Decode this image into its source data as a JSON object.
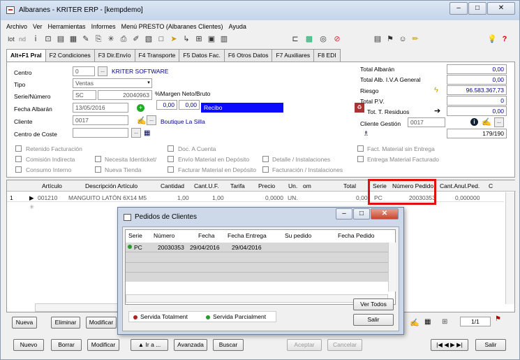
{
  "window": {
    "title": "Albaranes - KRITER ERP -  [kempdemo]"
  },
  "menu": [
    "Archivo",
    "Ver",
    "Herramientas",
    "Informes",
    "Menú PRESTO (Albaranes Clientes)",
    "Ayuda"
  ],
  "toolbar": {
    "icons": [
      "lot-icon",
      "nd-icon",
      "info-icon",
      "id-icon",
      "copy-icon",
      "print-preview-icon",
      "magic-icon",
      "print-icon",
      "asterisk-icon",
      "printer-icon",
      "chart-icon",
      "square-icon",
      "pin-icon",
      "arrow-icon",
      "screen-icon",
      "calc-icon",
      "module-icon",
      "warehouse-icon",
      "stamp-icon",
      "money-icon",
      "target-icon",
      "euro-icon",
      "map-icon",
      "folder-icon",
      "bulb-icon",
      "help-icon"
    ],
    "text_lot": "lot",
    "text_nd": "nd"
  },
  "tabs": [
    "Alt+F1 Pral",
    "F2 Condiciones",
    "F3 Dir.Envío",
    "F4 Transporte",
    "F5 Datos Fac.",
    "F6 Otros Datos",
    "F7 Auxiliares",
    "F8 EDI"
  ],
  "form": {
    "centro_label": "Centro",
    "centro_code": "0",
    "centro_name": "KRITER SOFTWARE",
    "tipo_label": "Tipo",
    "tipo_value": "Ventas",
    "serie_label": "Serie/Número",
    "serie_value": "SC",
    "numero_value": "20040963",
    "margen_label": "%Margen Neto/Bruto",
    "margen_neto": "0,00",
    "margen_bruto": "0,00",
    "recibo": "Recibo",
    "fecha_label": "Fecha Albarán",
    "fecha_value": "13/05/2016",
    "cliente_label": "Cliente",
    "cliente_code": "0017",
    "cliente_name": "Boutique La Silla",
    "coste_label": "Centro de Coste"
  },
  "totals": {
    "total_albaran_label": "Total Albarán",
    "total_albaran": "0,00",
    "total_iva_label": "Total Alb. I.V.A General",
    "total_iva": "0,00",
    "riesgo_label": "Riesgo",
    "riesgo": "96.583.367,73",
    "total_pv_label": "Total P.V.",
    "total_pv": "0",
    "residuos_label": "Tot. T. Residuos",
    "residuos": "0,00",
    "gestion_label": "Cliente Gestión",
    "gestion_code": "0017",
    "pager": "179/190"
  },
  "checks": [
    "Retenido Facturación",
    "Comisión Indirecta",
    "Necesita Identicket/",
    "Consumo Interno",
    "Nueva Tienda",
    "Doc. A Cuenta",
    "Envío Material en Depósito",
    "Detalle / Instalaciones",
    "Facturar Material en Depósito",
    "Facturación / Instalaciones",
    "Fact. Material sin Entrega",
    "Entrega Material Facturado"
  ],
  "grid": {
    "headers": [
      "Artículo",
      "Descripción Artículo",
      "Cantidad",
      "Cant.U.F.",
      "Tarifa",
      "Precio",
      "Un.",
      "om",
      "Total",
      "Serie",
      "Número Pedido",
      "Cant.Anul.Ped.",
      "C"
    ],
    "row": {
      "num": "1",
      "articulo": "001210",
      "descripcion": "MANGUITO LATÓN 6X14 M5",
      "cantidad": "1,00",
      "cantuf": "1,00",
      "precio": "0,0000",
      "un": "UN.",
      "total": "0,00",
      "serie": "PC",
      "pedido": "20030353",
      "anul": "0,000000"
    },
    "pager": "1/1"
  },
  "grid_buttons": [
    "Nueva",
    "Eliminar",
    "Modificar"
  ],
  "bottom_buttons": [
    "Nuevo",
    "Borrar",
    "Modificar",
    "Ir a ...",
    "Avanzada",
    "Buscar",
    "Aceptar",
    "Cancelar",
    "Salir"
  ],
  "dialog": {
    "title": "Pedidos de Clientes",
    "headers": [
      "Serie",
      "Número",
      "Fecha",
      "Fecha Entrega",
      "Su pedido",
      "Fecha Pedido"
    ],
    "row": {
      "serie": "PC",
      "numero": "20030353",
      "fecha": "29/04/2016",
      "entrega": "29/04/2016"
    },
    "legend_total": "Servida Totalment",
    "legend_parcial": "Servida Parcialment",
    "ver_todos": "Ver Todos",
    "salir": "Salir"
  }
}
